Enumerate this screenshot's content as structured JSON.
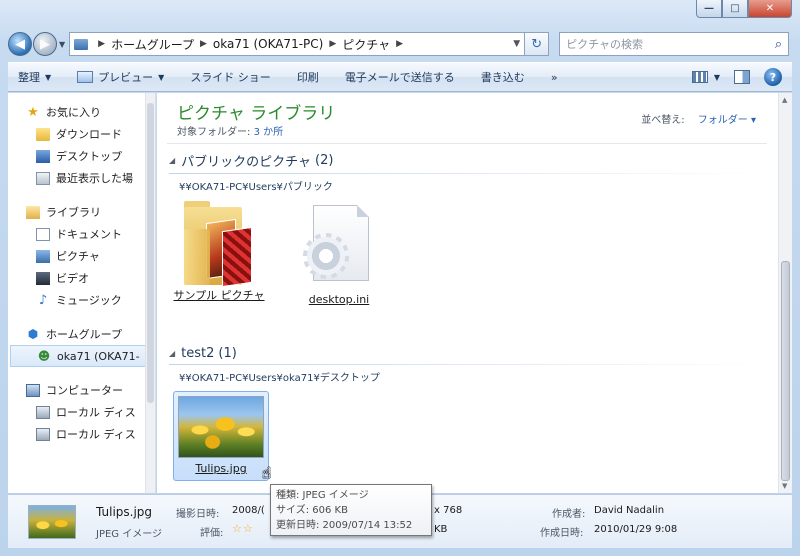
{
  "window": {
    "caption": {
      "min": "—",
      "max": "□",
      "close": "✕"
    }
  },
  "address": {
    "crumbs": [
      "ホームグループ",
      "oka71 (OKA71-PC)",
      "ピクチャ"
    ],
    "refresh_icon": "refresh-icon"
  },
  "search": {
    "placeholder": "ピクチャの検索"
  },
  "toolbar": {
    "organize": "整理",
    "preview": "プレビュー",
    "slideshow": "スライド ショー",
    "print": "印刷",
    "email": "電子メールで送信する",
    "burn": "書き込む",
    "more": "»"
  },
  "sidebar": {
    "favorites": "お気に入り",
    "downloads": "ダウンロード",
    "desktop": "デスクトップ",
    "recent": "最近表示した場",
    "libraries": "ライブラリ",
    "documents": "ドキュメント",
    "pictures": "ピクチャ",
    "videos": "ビデオ",
    "music": "ミュージック",
    "homegroup": "ホームグループ",
    "user": "oka71 (OKA71-",
    "computer": "コンピューター",
    "disk1": "ローカル ディス",
    "disk2": "ローカル ディス"
  },
  "library": {
    "title": "ピクチャ ライブラリ",
    "target_label": "対象フォルダー:",
    "target_value": "3 か所",
    "arrange_label": "並べ替え:",
    "arrange_value": "フォルダー"
  },
  "groups": [
    {
      "name": "パブリックのピクチャ",
      "count": "(2)",
      "path": "¥¥OKA71-PC¥Users¥パブリック",
      "files": [
        "サンプル ピクチャ",
        "desktop.ini"
      ]
    },
    {
      "name": "test2",
      "count": "(1)",
      "path": "¥¥OKA71-PC¥Users¥oka71¥デスクトップ",
      "files": [
        "Tulips.jpg"
      ]
    }
  ],
  "details": {
    "name": "Tulips.jpg",
    "type": "JPEG イメージ",
    "shot_label": "撮影日時:",
    "shot_value": "2008/(",
    "rating_label": "評価:",
    "rating_stars": "☆☆",
    "dim_value": "x 768",
    "size_tail": "KB",
    "author_label": "作成者:",
    "author_value": "David Nadalin",
    "created_label": "作成日時:",
    "created_value": "2010/01/29 9:08"
  },
  "tooltip": {
    "type_row": "種類: JPEG イメージ",
    "size_row": "サイズ: 606 KB",
    "modified_row": "更新日時: 2009/07/14 13:52"
  }
}
